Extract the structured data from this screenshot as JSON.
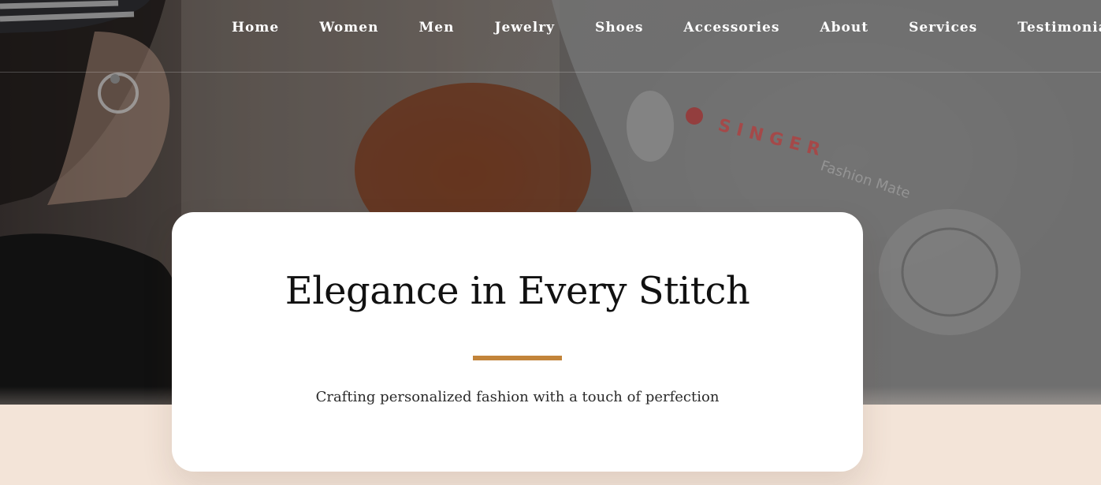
{
  "nav": {
    "items": [
      {
        "label": "Home"
      },
      {
        "label": "Women"
      },
      {
        "label": "Men"
      },
      {
        "label": "Jewelry"
      },
      {
        "label": "Shoes"
      },
      {
        "label": "Accessories"
      },
      {
        "label": "About"
      },
      {
        "label": "Services"
      },
      {
        "label": "Testimonials"
      }
    ]
  },
  "hero": {
    "photo_text": {
      "brand": "SINGER",
      "model": "Fashion Mate"
    }
  },
  "card": {
    "title": "Elegance in Every Stitch",
    "subtitle": "Crafting personalized fashion with a touch of perfection"
  },
  "colors": {
    "accent": "#c2843a",
    "page_background": "#f3e4d8",
    "card_background": "#ffffff",
    "nav_text": "#ffffff"
  }
}
